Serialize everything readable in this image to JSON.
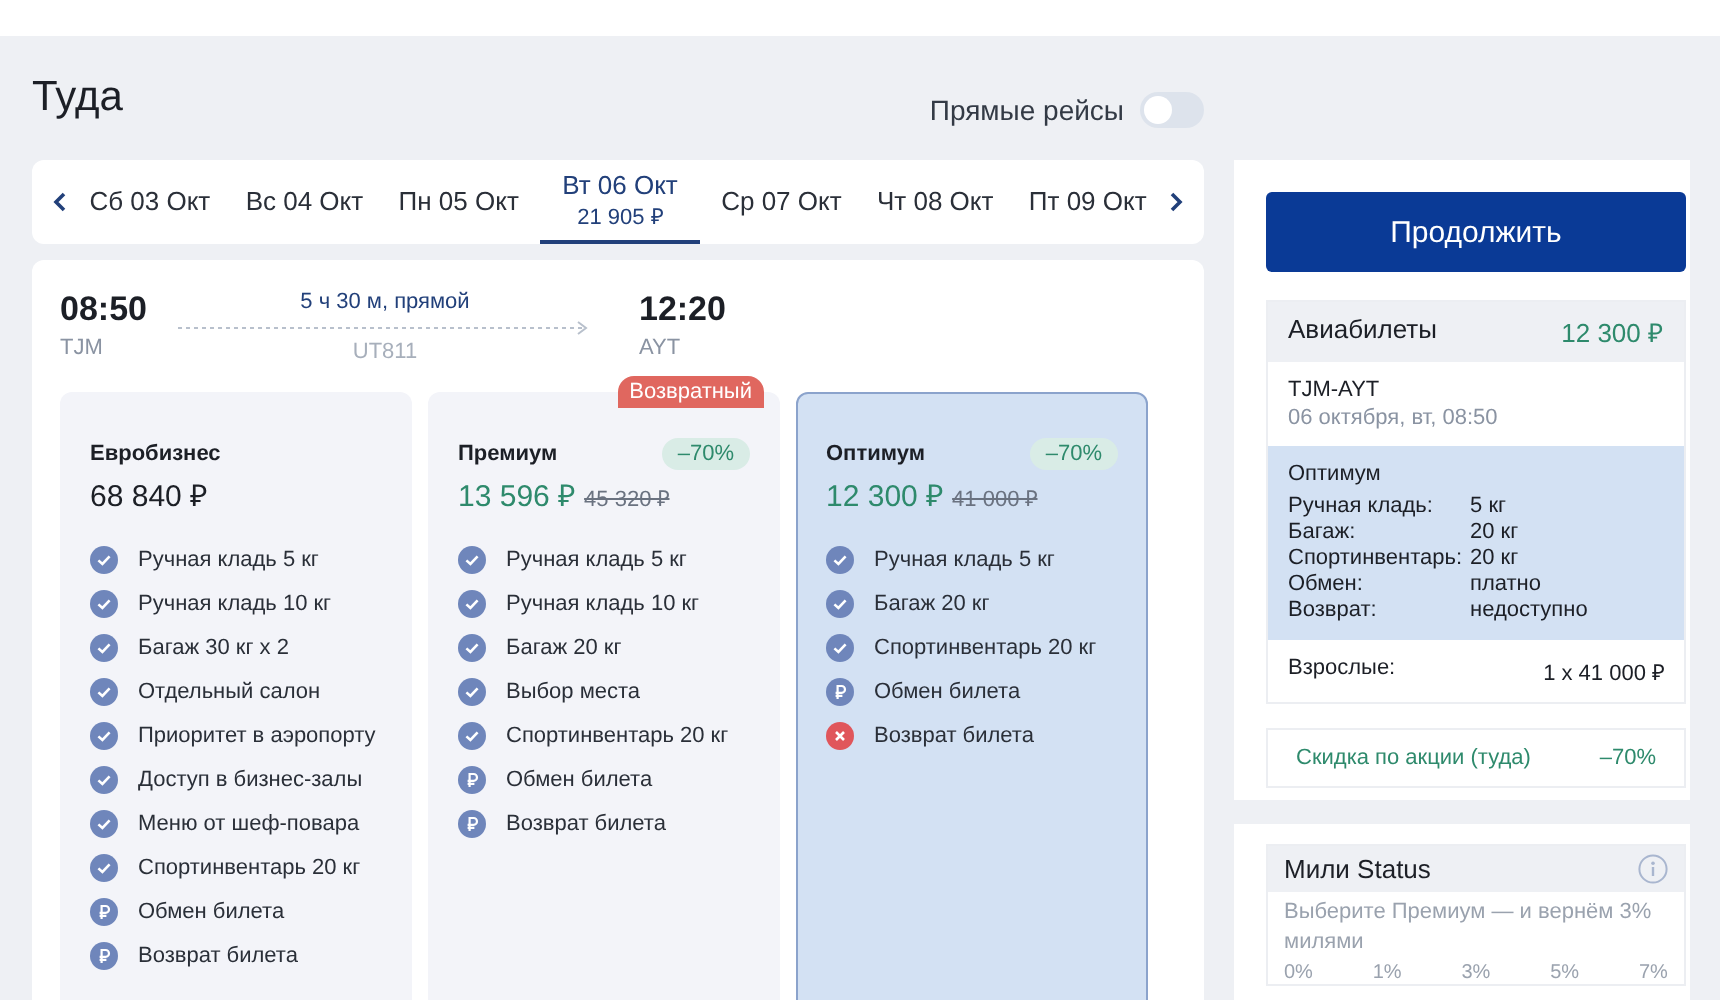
{
  "direction_title": "Туда",
  "direct_filter": {
    "label": "Прямые рейсы",
    "on": false
  },
  "dates": [
    {
      "label": "Сб 03 Окт",
      "selected": false
    },
    {
      "label": "Вс 04 Окт",
      "selected": false
    },
    {
      "label": "Пн 05 Окт",
      "selected": false
    },
    {
      "label": "Вт 06 Окт",
      "price": "21 905 ₽",
      "selected": true
    },
    {
      "label": "Ср 07 Окт",
      "selected": false
    },
    {
      "label": "Чт 08 Окт",
      "selected": false
    },
    {
      "label": "Пт 09 Окт",
      "selected": false
    }
  ],
  "flight": {
    "depart_time": "08:50",
    "depart_code": "TJM",
    "duration": "5 ч 30 м, прямой",
    "flight_number": "UT811",
    "arrive_time": "12:20",
    "arrive_code": "AYT"
  },
  "fares": [
    {
      "name": "Евробизнес",
      "price": "68 840 ₽",
      "selected": false,
      "features": [
        {
          "text": "Ручная кладь 5 кг",
          "kind": "included"
        },
        {
          "text": "Ручная кладь 10 кг",
          "kind": "included"
        },
        {
          "text": "Багаж 30 кг x 2",
          "kind": "included"
        },
        {
          "text": "Отдельный салон",
          "kind": "included"
        },
        {
          "text": "Приоритет в аэропорту",
          "kind": "included"
        },
        {
          "text": "Доступ в бизнес-залы",
          "kind": "included"
        },
        {
          "text": "Меню от шеф-повара",
          "kind": "included"
        },
        {
          "text": "Спортинвентарь 20 кг",
          "kind": "included"
        },
        {
          "text": "Обмен билета",
          "kind": "paid"
        },
        {
          "text": "Возврат билета",
          "kind": "paid"
        }
      ]
    },
    {
      "name": "Премиум",
      "badge": "Возвратный",
      "discount": "–70%",
      "price": "13 596 ₽",
      "old_price": "45 320 ₽",
      "selected": false,
      "features": [
        {
          "text": "Ручная кладь 5 кг",
          "kind": "included"
        },
        {
          "text": "Ручная кладь 10 кг",
          "kind": "included"
        },
        {
          "text": "Багаж 20 кг",
          "kind": "included"
        },
        {
          "text": "Выбор места",
          "kind": "included"
        },
        {
          "text": "Спортинвентарь 20 кг",
          "kind": "included"
        },
        {
          "text": "Обмен билета",
          "kind": "paid"
        },
        {
          "text": "Возврат билета",
          "kind": "paid"
        }
      ]
    },
    {
      "name": "Оптимум",
      "discount": "–70%",
      "price": "12 300 ₽",
      "old_price": "41 000 ₽",
      "selected": true,
      "features": [
        {
          "text": "Ручная кладь 5 кг",
          "kind": "included"
        },
        {
          "text": "Багаж 20 кг",
          "kind": "included"
        },
        {
          "text": "Спортинвентарь 20 кг",
          "kind": "included"
        },
        {
          "text": "Обмен билета",
          "kind": "paid"
        },
        {
          "text": "Возврат билета",
          "kind": "unavailable"
        }
      ]
    }
  ],
  "continue_button": "Продолжить",
  "summary": {
    "title": "Авиабилеты",
    "total": "12 300 ₽",
    "route": "TJM-AYT",
    "date": "06 октября, вт, 08:50",
    "fare": "Оптимум",
    "details": [
      {
        "label": "Ручная кладь:",
        "value": "5 кг"
      },
      {
        "label": "Багаж:",
        "value": "20 кг"
      },
      {
        "label": "Спортинвентарь:",
        "value": "20 кг"
      },
      {
        "label": "Обмен:",
        "value": "платно"
      },
      {
        "label": "Возврат:",
        "value": "недоступно"
      }
    ],
    "passengers": {
      "label": "Взрослые:",
      "value": "1 x 41 000 ₽"
    }
  },
  "promo": {
    "label": "Скидка по акции (туда)",
    "value": "–70%"
  },
  "miles": {
    "title": "Мили Status",
    "hint": "Выберите Премиум — и вернём 3% милями",
    "scale": [
      "0%",
      "1%",
      "3%",
      "5%",
      "7%"
    ]
  }
}
